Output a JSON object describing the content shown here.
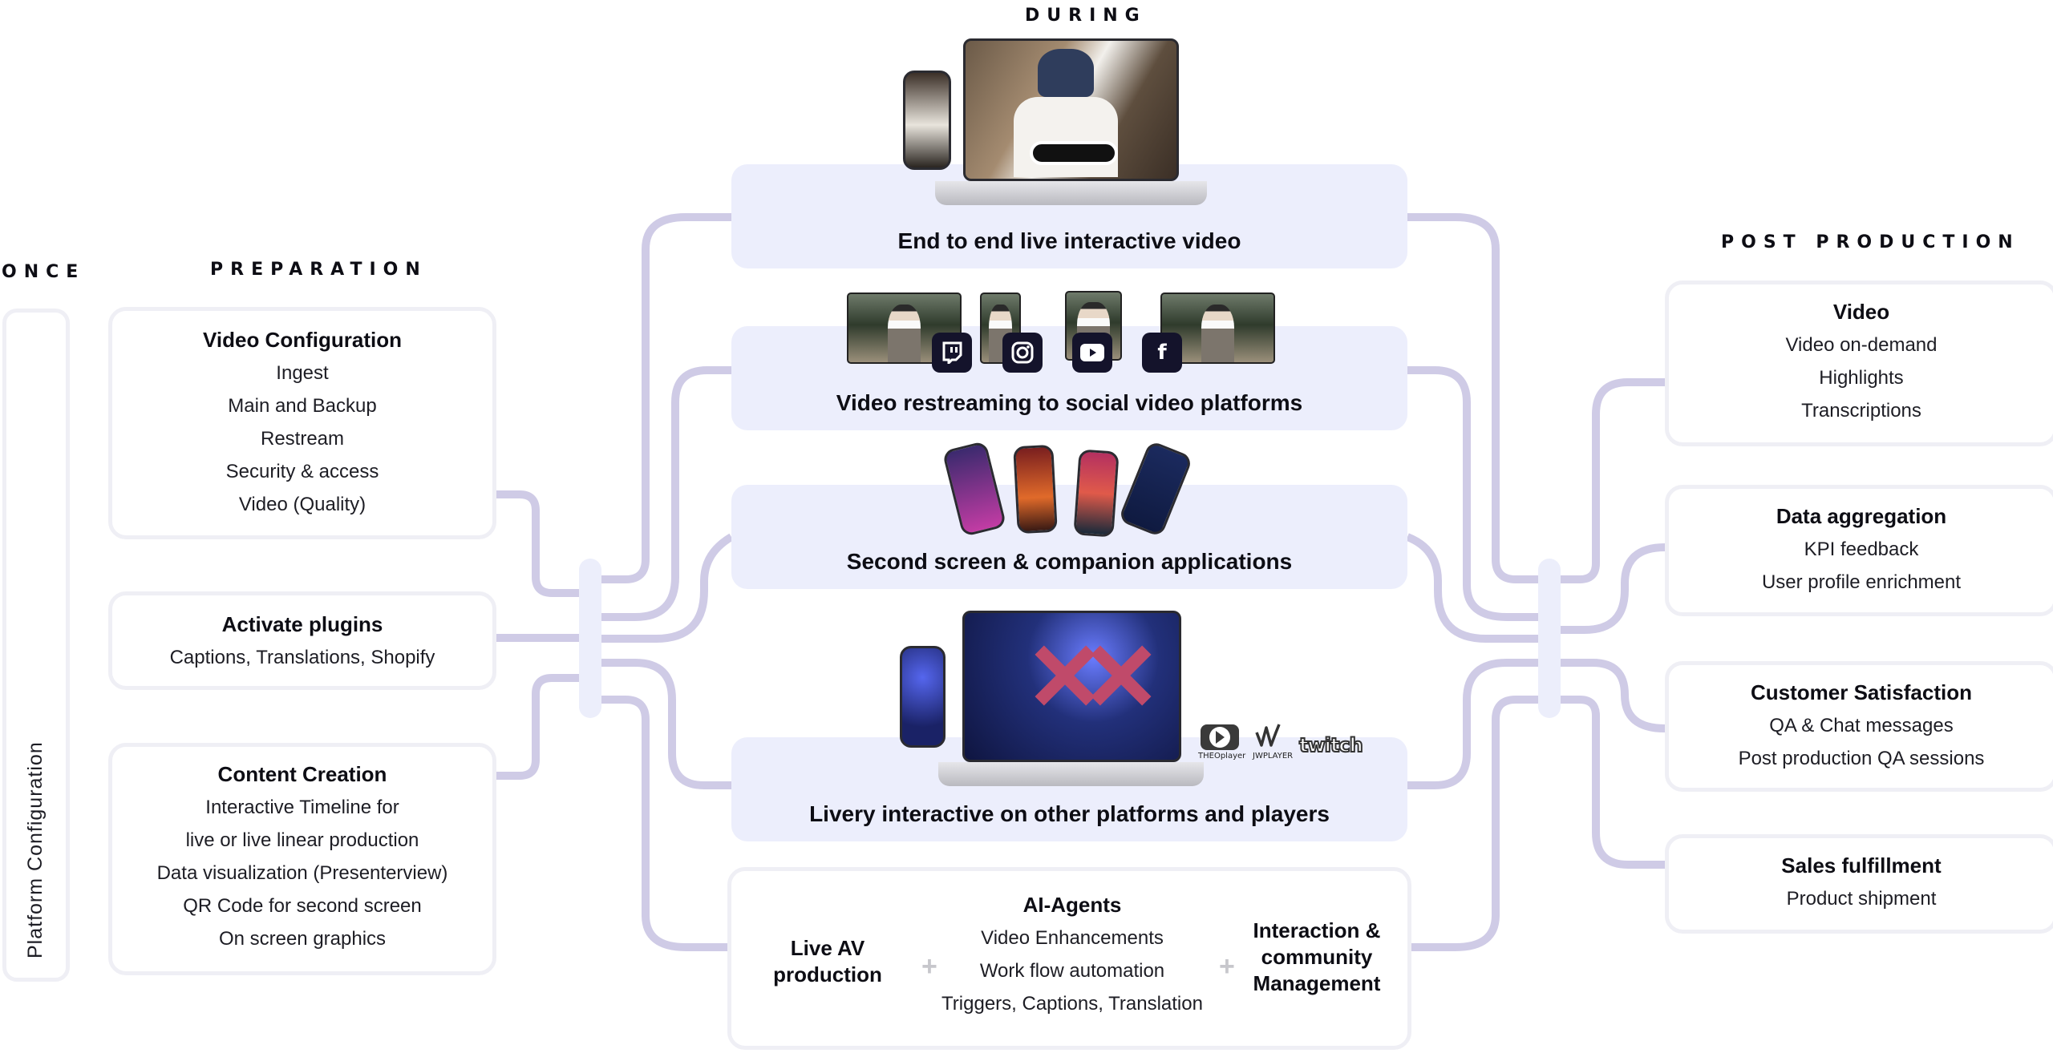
{
  "phases": {
    "once": "ONCE",
    "preparation": "PREPARATION",
    "during": "DURING",
    "post_production": "POST PRODUCTION"
  },
  "once": {
    "platform_configuration": "Platform Configuration"
  },
  "preparation": {
    "cards": [
      {
        "title": "Video Configuration",
        "lines": [
          "Ingest",
          "Main and Backup",
          "Restream",
          "Security & access",
          "Video (Quality)"
        ]
      },
      {
        "title": "Activate plugins",
        "lines": [
          "Captions, Translations, Shopify"
        ]
      },
      {
        "title": "Content Creation",
        "lines": [
          "Interactive Timeline for",
          "live or live linear production",
          "Data visualization (Presenterview)",
          "QR Code for second screen",
          "On screen graphics"
        ]
      }
    ]
  },
  "during": {
    "boxes": [
      {
        "title": "End to end live interactive video",
        "illustration": "laptop-and-phone-live-shopping"
      },
      {
        "title": "Video restreaming to social video platforms",
        "illustration": "social-thumbnails",
        "platform_icons": [
          "twitch-icon",
          "instagram-icon",
          "youtube-icon",
          "facebook-icon"
        ]
      },
      {
        "title": "Second screen & companion applications",
        "illustration": "four-phones"
      },
      {
        "title": "Livery interactive on other platforms and players",
        "illustration": "laptop-and-phone-show",
        "player_logos": [
          "THEOplayer",
          "JWPLAYER",
          "twitch"
        ]
      }
    ],
    "production": {
      "left": "Live AV production",
      "plus_symbol": "+",
      "middle_title": "AI-Agents",
      "middle_lines": [
        "Video Enhancements",
        "Work flow automation",
        "Triggers, Captions, Translation"
      ],
      "right": "Interaction & community Management"
    }
  },
  "post_production": {
    "cards": [
      {
        "title": "Video",
        "lines": [
          "Video on-demand",
          "Highlights",
          "Transcriptions"
        ]
      },
      {
        "title": "Data aggregation",
        "lines": [
          "KPI feedback",
          "User profile enrichment"
        ]
      },
      {
        "title": "Customer Satisfaction",
        "lines": [
          "QA & Chat messages",
          "Post production QA sessions"
        ]
      },
      {
        "title": "Sales fulfillment",
        "lines": [
          "Product shipment"
        ]
      }
    ]
  },
  "colors": {
    "connector": "#cfcbe6",
    "hub": "#eceefb",
    "during_box": "#eceefc",
    "card_border": "#efeff5",
    "icon_tile": "#14132b"
  }
}
